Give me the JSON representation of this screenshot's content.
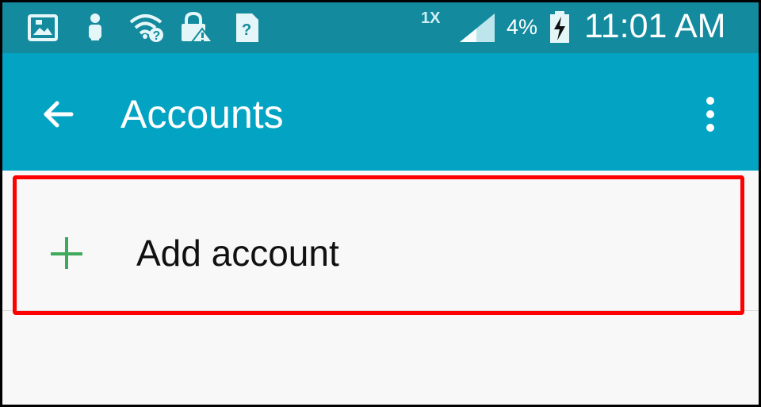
{
  "status_bar": {
    "network_type": "1X",
    "battery_percent": "4%",
    "time": "11:01 AM",
    "icons": [
      "gallery-icon",
      "person-icon",
      "wifi-question-icon",
      "lock-warning-icon",
      "sim-question-icon",
      "signal-icon",
      "battery-charging-icon"
    ]
  },
  "app_bar": {
    "title": "Accounts",
    "back_icon": "back-arrow-icon",
    "menu_icon": "more-vertical-icon"
  },
  "accounts": {
    "add_label": "Add account",
    "add_icon": "plus-icon"
  },
  "colors": {
    "status_bar": "#138a9e",
    "app_bar": "#03a4c3",
    "background": "#f8f8f8",
    "accent": "#3ea95a",
    "highlight": "#ff0000"
  }
}
